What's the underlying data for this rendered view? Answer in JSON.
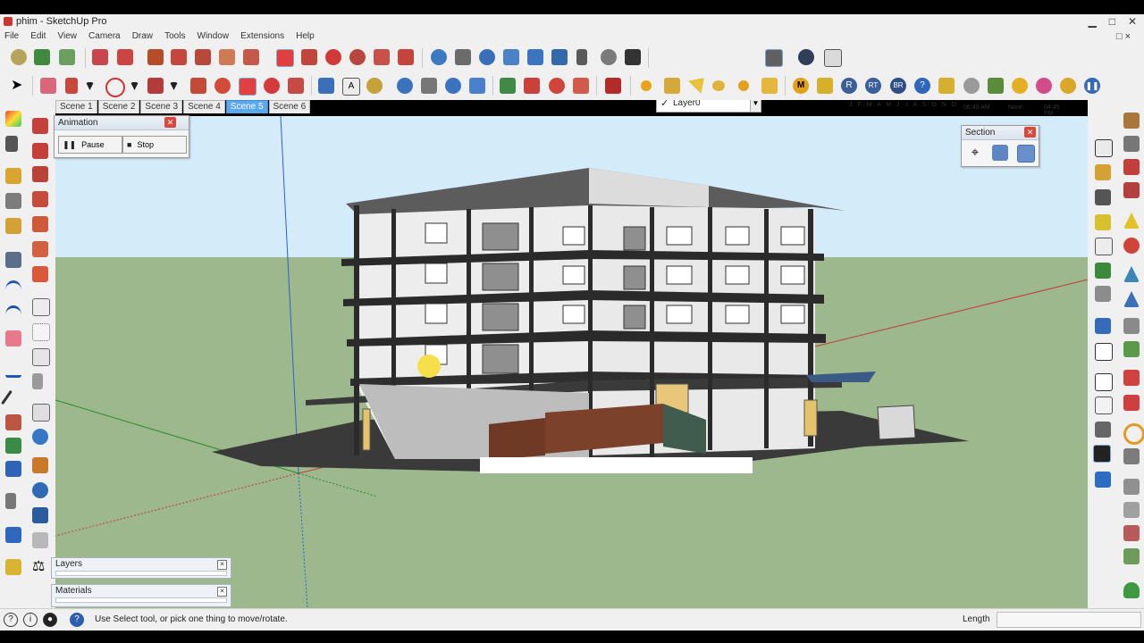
{
  "window": {
    "title": "phim - SketchUp Pro"
  },
  "window_controls": {
    "minimize": "▁",
    "maximize": "□",
    "close": "✕"
  },
  "menu": {
    "items": [
      "File",
      "Edit",
      "View",
      "Camera",
      "Draw",
      "Tools",
      "Window",
      "Extensions",
      "Help"
    ],
    "restore_icon": "□ ×"
  },
  "layer_select": {
    "value": "Layer0",
    "check": "✓"
  },
  "shadow_settings": {
    "months": "J F M A M J J A S O N D",
    "time_start": "06:43 AM",
    "time_noon": "Noon",
    "time_end": "04:45 PM"
  },
  "scenes": {
    "tabs": [
      "Scene 1",
      "Scene 2",
      "Scene 3",
      "Scene 4",
      "Scene 5",
      "Scene 6"
    ],
    "active_index": 4
  },
  "animation_dialog": {
    "title": "Animation",
    "pause_label": "Pause",
    "stop_label": "Stop"
  },
  "section_dialog": {
    "title": "Section"
  },
  "panels": {
    "layers_title": "Layers",
    "materials_title": "Materials"
  },
  "statusbar": {
    "message": "Use Select tool, or pick one thing to move/rotate.",
    "vcb_label": "Length",
    "vcb_value": ""
  },
  "colors": {
    "sky": "#d4ecfa",
    "ground": "#9db88d",
    "active_tab": "#5aa9ef"
  }
}
